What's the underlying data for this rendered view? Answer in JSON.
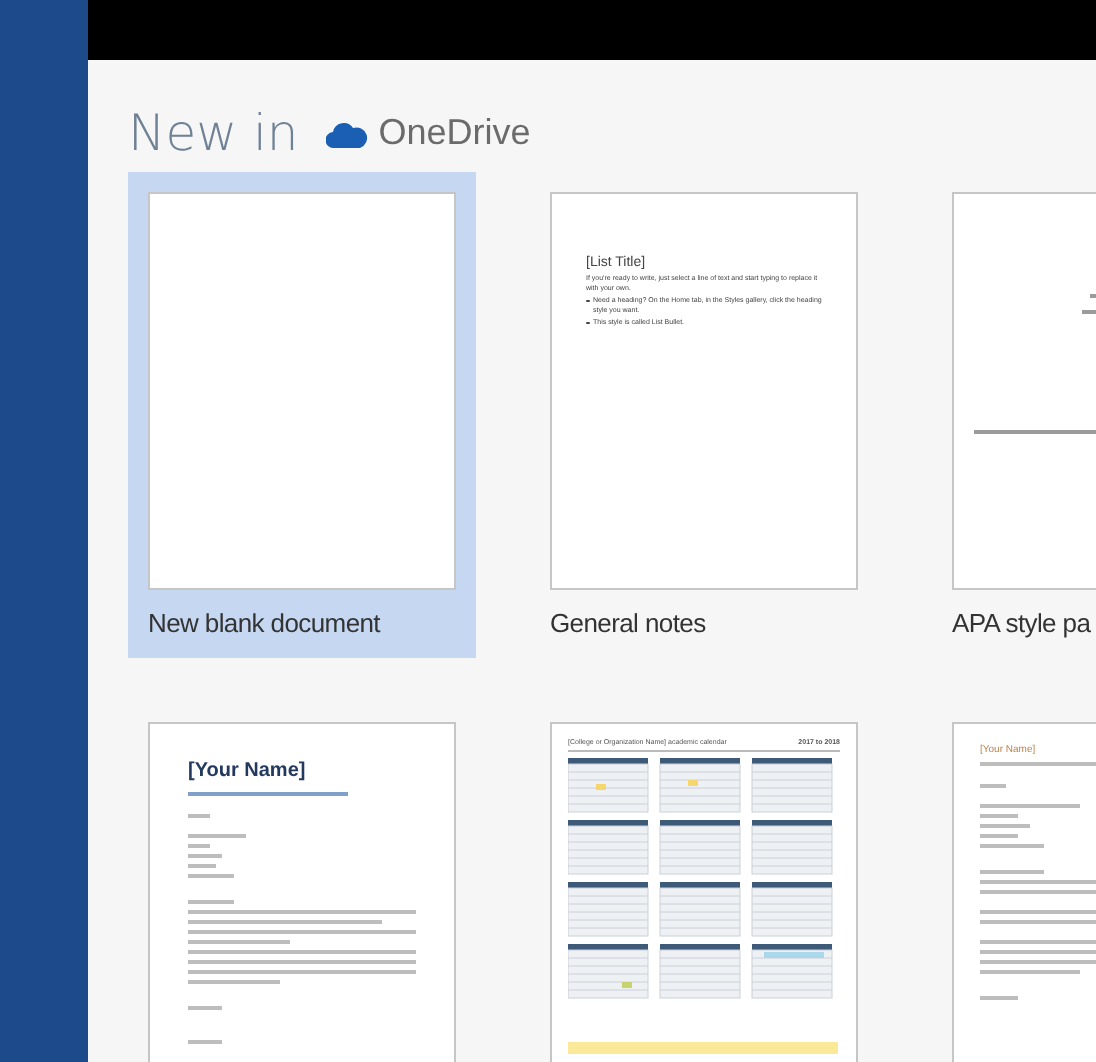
{
  "heading": {
    "prefix": "New in",
    "service": "OneDrive"
  },
  "templates": [
    {
      "kind": "blank",
      "label": "New blank document",
      "selected": true
    },
    {
      "kind": "list",
      "label": "General notes",
      "selected": false,
      "title": "[List Title]",
      "body": "If you're ready to write, just select a line of text and start typing to replace it with your own.",
      "bullets": [
        "Need a heading? On the Home tab, in the Styles gallery, click the heading style you want.",
        "This style is called List Bullet."
      ]
    },
    {
      "kind": "apa",
      "label": "APA style pa",
      "selected": false
    },
    {
      "kind": "letter",
      "selected": false,
      "title": "[Your Name]"
    },
    {
      "kind": "calendar",
      "selected": false,
      "title": "[College or Organization Name] academic calendar",
      "years": "2017 to 2018"
    },
    {
      "kind": "resume",
      "selected": false,
      "title": "[Your Name]"
    }
  ]
}
